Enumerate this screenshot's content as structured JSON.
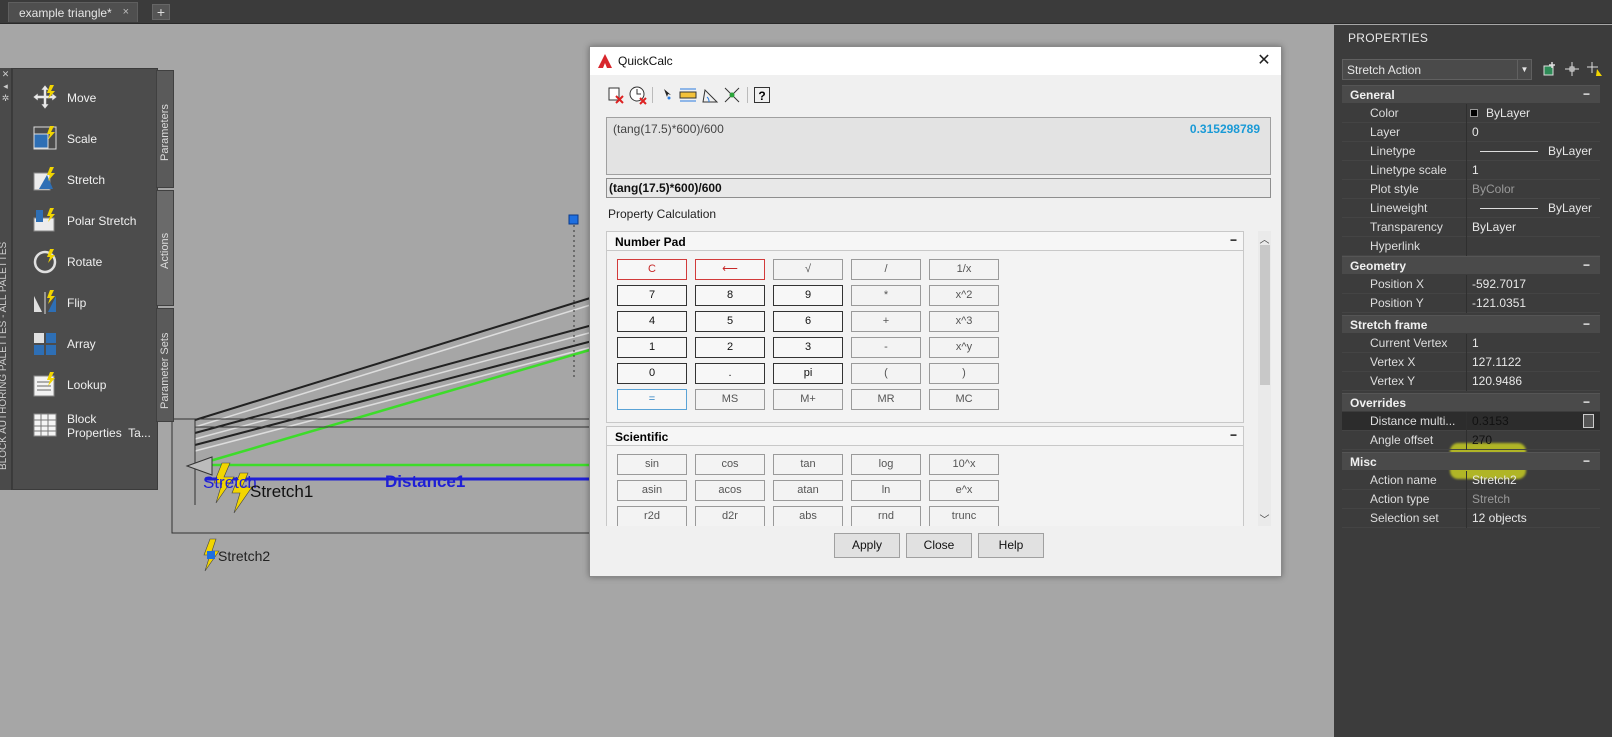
{
  "doc_tab": {
    "title": "example triangle*",
    "close": "×",
    "new": "+"
  },
  "palette": {
    "vertical_title": "BLOCK AUTHORING PALETTES - ALL PALETTES",
    "controls": [
      "✕",
      "◂",
      "✲"
    ],
    "tabs": {
      "parameters": "Parameters",
      "actions": "Actions",
      "parameter_sets": "Parameter Sets"
    },
    "items": [
      {
        "label": "Move",
        "icon": "move-action-icon"
      },
      {
        "label": "Scale",
        "icon": "scale-action-icon"
      },
      {
        "label": "Stretch",
        "icon": "stretch-action-icon"
      },
      {
        "label": "Polar Stretch",
        "icon": "polar-stretch-action-icon"
      },
      {
        "label": "Rotate",
        "icon": "rotate-action-icon"
      },
      {
        "label": "Flip",
        "icon": "flip-action-icon"
      },
      {
        "label": "Array",
        "icon": "array-action-icon"
      },
      {
        "label": "Lookup",
        "icon": "lookup-action-icon"
      },
      {
        "label": "Block\nProperties  Ta...",
        "icon": "block-properties-table-icon"
      }
    ]
  },
  "drawing": {
    "labels": {
      "stretch_overlap": "Stretch",
      "stretch1": "Stretch1",
      "distance1": "Distance1",
      "stretch2": "Stretch2"
    },
    "colors": {
      "distance_line": "#1f1fd6",
      "green_line": "#3ddc2a",
      "grip": "#1e6fe0"
    }
  },
  "dialog": {
    "title": "QuickCalc",
    "close": "✕",
    "display": {
      "expression": "(tang(17.5)*600)/600",
      "result": "0.315298789"
    },
    "input_value": "(tang(17.5)*600)/600",
    "property_calculation": "Property Calculation",
    "number_pad": {
      "title": "Number Pad",
      "collapse": "−",
      "rows": [
        [
          "C",
          "⟵",
          "√",
          "/",
          "1/x"
        ],
        [
          "7",
          "8",
          "9",
          "*",
          "x^2"
        ],
        [
          "4",
          "5",
          "6",
          "+",
          "x^3"
        ],
        [
          "1",
          "2",
          "3",
          "-",
          "x^y"
        ],
        [
          "0",
          ".",
          "pi",
          "(",
          ")"
        ],
        [
          "=",
          "MS",
          "M+",
          "MR",
          "MC"
        ]
      ]
    },
    "scientific": {
      "title": "Scientific",
      "collapse": "−",
      "rows": [
        [
          "sin",
          "cos",
          "tan",
          "log",
          "10^x"
        ],
        [
          "asin",
          "acos",
          "atan",
          "ln",
          "e^x"
        ],
        [
          "r2d",
          "d2r",
          "abs",
          "rnd",
          "trunc"
        ]
      ]
    },
    "buttons": {
      "apply": "Apply",
      "close": "Close",
      "help": "Help"
    },
    "help_icon": "?"
  },
  "properties": {
    "title": "PROPERTIES",
    "selection": "Stretch Action",
    "categories": {
      "general": {
        "title": "General",
        "collapse": "−"
      },
      "geometry": {
        "title": "Geometry",
        "collapse": "−"
      },
      "stretch_frame": {
        "title": "Stretch frame",
        "collapse": "−"
      },
      "overrides": {
        "title": "Overrides",
        "collapse": "−"
      },
      "misc": {
        "title": "Misc",
        "collapse": "−"
      }
    },
    "general": [
      {
        "key": "Color",
        "value": "ByLayer"
      },
      {
        "key": "Layer",
        "value": "0"
      },
      {
        "key": "Linetype",
        "value": "ByLayer"
      },
      {
        "key": "Linetype scale",
        "value": "1"
      },
      {
        "key": "Plot style",
        "value": "ByColor"
      },
      {
        "key": "Lineweight",
        "value": "ByLayer"
      },
      {
        "key": "Transparency",
        "value": "ByLayer"
      },
      {
        "key": "Hyperlink",
        "value": ""
      }
    ],
    "geometry": [
      {
        "key": "Position X",
        "value": "-592.7017"
      },
      {
        "key": "Position Y",
        "value": "-121.0351"
      }
    ],
    "stretch_frame": [
      {
        "key": "Current Vertex",
        "value": "1"
      },
      {
        "key": "Vertex X",
        "value": "127.1122"
      },
      {
        "key": "Vertex Y",
        "value": "120.9486"
      }
    ],
    "overrides": [
      {
        "key": "Distance  multi...",
        "value": "0.3153"
      },
      {
        "key": "Angle offset",
        "value": "270"
      }
    ],
    "misc": [
      {
        "key": "Action name",
        "value": "Stretch2"
      },
      {
        "key": "Action type",
        "value": "Stretch"
      },
      {
        "key": "Selection set",
        "value": "12 objects"
      }
    ],
    "highlight_color": "#d7de1f"
  }
}
